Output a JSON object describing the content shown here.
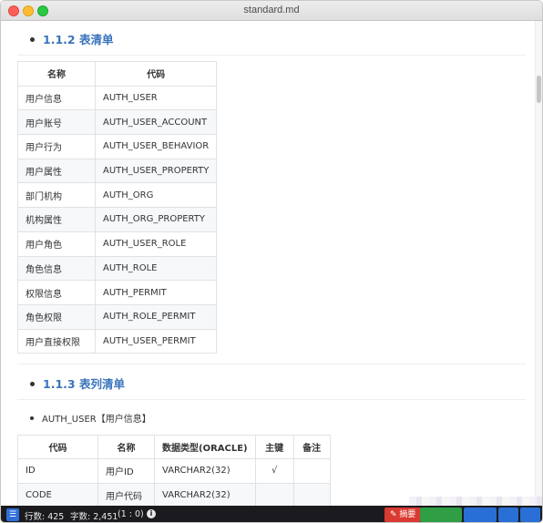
{
  "window": {
    "title": "standard.md"
  },
  "section1": {
    "heading": "1.1.2 表清单"
  },
  "table1": {
    "headers": [
      "名称",
      "代码"
    ],
    "rows": [
      [
        "用户信息",
        "AUTH_USER"
      ],
      [
        "用户账号",
        "AUTH_USER_ACCOUNT"
      ],
      [
        "用户行为",
        "AUTH_USER_BEHAVIOR"
      ],
      [
        "用户属性",
        "AUTH_USER_PROPERTY"
      ],
      [
        "部门机构",
        "AUTH_ORG"
      ],
      [
        "机构属性",
        "AUTH_ORG_PROPERTY"
      ],
      [
        "用户角色",
        "AUTH_USER_ROLE"
      ],
      [
        "角色信息",
        "AUTH_ROLE"
      ],
      [
        "权限信息",
        "AUTH_PERMIT"
      ],
      [
        "角色权限",
        "AUTH_ROLE_PERMIT"
      ],
      [
        "用户直接权限",
        "AUTH_USER_PERMIT"
      ]
    ]
  },
  "section2": {
    "heading": "1.1.3 表列清单"
  },
  "subsection": {
    "label": "AUTH_USER【用户信息】"
  },
  "table2": {
    "headers": [
      "代码",
      "名称",
      "数据类型(ORACLE)",
      "主键",
      "备注"
    ],
    "rows": [
      [
        "ID",
        "用户ID",
        "VARCHAR2(32)",
        "√",
        ""
      ],
      [
        "CODE",
        "用户代码",
        "VARCHAR2(32)",
        "",
        ""
      ]
    ]
  },
  "statusbar": {
    "lines": "行数: 425",
    "chars": "字数: 2,451",
    "position": "(1 : 0)",
    "btn_red": "摘要",
    "icon_left": "sidebar-toggle-icon",
    "info_icon": "info-icon"
  },
  "colors": {
    "heading": "#3874bb",
    "statusbar_bg": "#1b1b1f",
    "accent_red": "#d93a32",
    "accent_green": "#2f9e44",
    "accent_blue": "#2a6fd6"
  }
}
